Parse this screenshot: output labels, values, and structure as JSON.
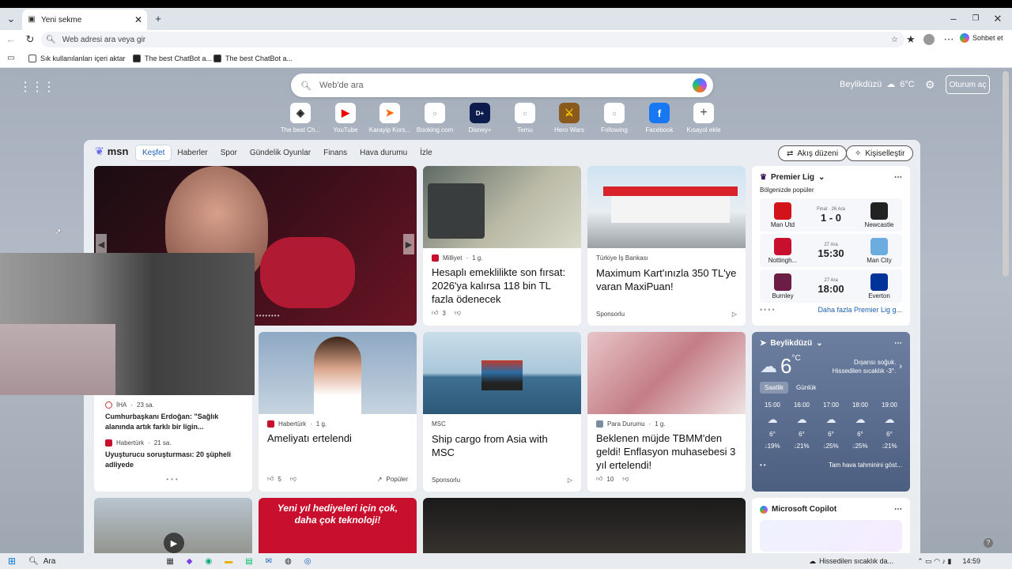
{
  "browser": {
    "tab_title": "Yeni sekme",
    "address_placeholder": "Web adresi ara veya gir",
    "copilot_label": "Sohbet et",
    "favorites": [
      "Sık kullanılanları içeri aktar",
      "The best ChatBot a...",
      "The best ChatBot a..."
    ]
  },
  "newtab": {
    "search_placeholder": "Web'de ara",
    "weather_city": "Beylikdüzü",
    "weather_temp": "6°C",
    "login_label": "Oturum aç",
    "quick_links": [
      "The best Ch...",
      "YouTube",
      "Karayip Kors...",
      "Booking.com",
      "Disney+",
      "Temu",
      "Hero Wars",
      "Following",
      "Facebook",
      "Kısayol ekle"
    ]
  },
  "feed": {
    "brand": "msn",
    "nav": [
      "Keşfet",
      "Haberler",
      "Spor",
      "Gündelik Oyunlar",
      "Finans",
      "Hava durumu",
      "İzle"
    ],
    "layout_label": "Akış düzeni",
    "personalize_label": "Kişiselleştir",
    "cards": [
      {
        "source": "Milliyet",
        "time": "1 g.",
        "title": "Hesaplı emeklilikte son fırsat: 2026'ya kalırsa 118 bin TL fazla ödenecek",
        "likes": "3"
      },
      {
        "source": "Türkiye İş Bankası",
        "title": "Maximum Kart'ınızla 350 TL'ye varan MaxiPuan!",
        "sponsor": "Sponsorlu"
      },
      {
        "source": "Habertürk",
        "time": "1 g.",
        "title": "Ameliyatı ertelendi",
        "likes": "5",
        "tag": "Popüler"
      },
      {
        "source": "MSC",
        "title": "Ship cargo from Asia with MSC",
        "sponsor": "Sponsorlu"
      },
      {
        "source": "Para Durumu",
        "time": "1 g.",
        "title": "Beklenen müjde TBMM'den geldi! Enflasyon muhasebesi 3 yıl ertelendi!",
        "likes": "10"
      }
    ],
    "small_news": [
      {
        "source": "İHA",
        "time": "23 sa.",
        "title": "Cumhurbaşkanı Erdoğan: \"Sağlık alanında artık farklı bir ligin..."
      },
      {
        "source": "Habertürk",
        "time": "21 sa.",
        "title": "Uyuşturucu soruşturması: 20 şüpheli adliyede"
      }
    ],
    "promo_text": "Yeni yıl hediyeleri için çok, daha çok teknoloji!"
  },
  "league": {
    "name": "Premier Lig",
    "subtitle": "Bölgenizde popüler",
    "more": "Daha fazla Premier Lig g...",
    "matches": [
      {
        "home": "Man Utd",
        "away": "Newcastle",
        "status": "Final · 26 Ara",
        "score": "1 - 0",
        "home_color": "#d3131a",
        "away_color": "#222222"
      },
      {
        "home": "Nottingh...",
        "away": "Man City",
        "status": "27 Ara",
        "score": "15:30",
        "home_color": "#c8102e",
        "away_color": "#6caddf"
      },
      {
        "home": "Burnley",
        "away": "Everton",
        "status": "27 Ara",
        "score": "18:00",
        "home_color": "#6c1d45",
        "away_color": "#003399"
      }
    ]
  },
  "weather": {
    "city": "Beylikdüzü",
    "temp": "6",
    "unit": "°C",
    "desc1": "Dışarısı soğuk.",
    "desc2": "Hissedilen sıcaklık -3°.",
    "tab_hourly": "Saatlik",
    "tab_daily": "Günlük",
    "more": "Tam hava tahminini göst...",
    "hours": [
      {
        "t": "15:00",
        "v": "6°",
        "p": "19%"
      },
      {
        "t": "16:00",
        "v": "6°",
        "p": "21%"
      },
      {
        "t": "17:00",
        "v": "6°",
        "p": "25%"
      },
      {
        "t": "18:00",
        "v": "6°",
        "p": "25%"
      },
      {
        "t": "19:00",
        "v": "6°",
        "p": "21%"
      }
    ]
  },
  "copilot": {
    "title": "Microsoft Copilot"
  },
  "taskbar": {
    "search": "Ara",
    "notice": "Hissedilen sıcaklık da...",
    "time": "14:59"
  },
  "colors": {
    "accent": "#1a5fb4",
    "weather_bg": "#5b6f93"
  }
}
